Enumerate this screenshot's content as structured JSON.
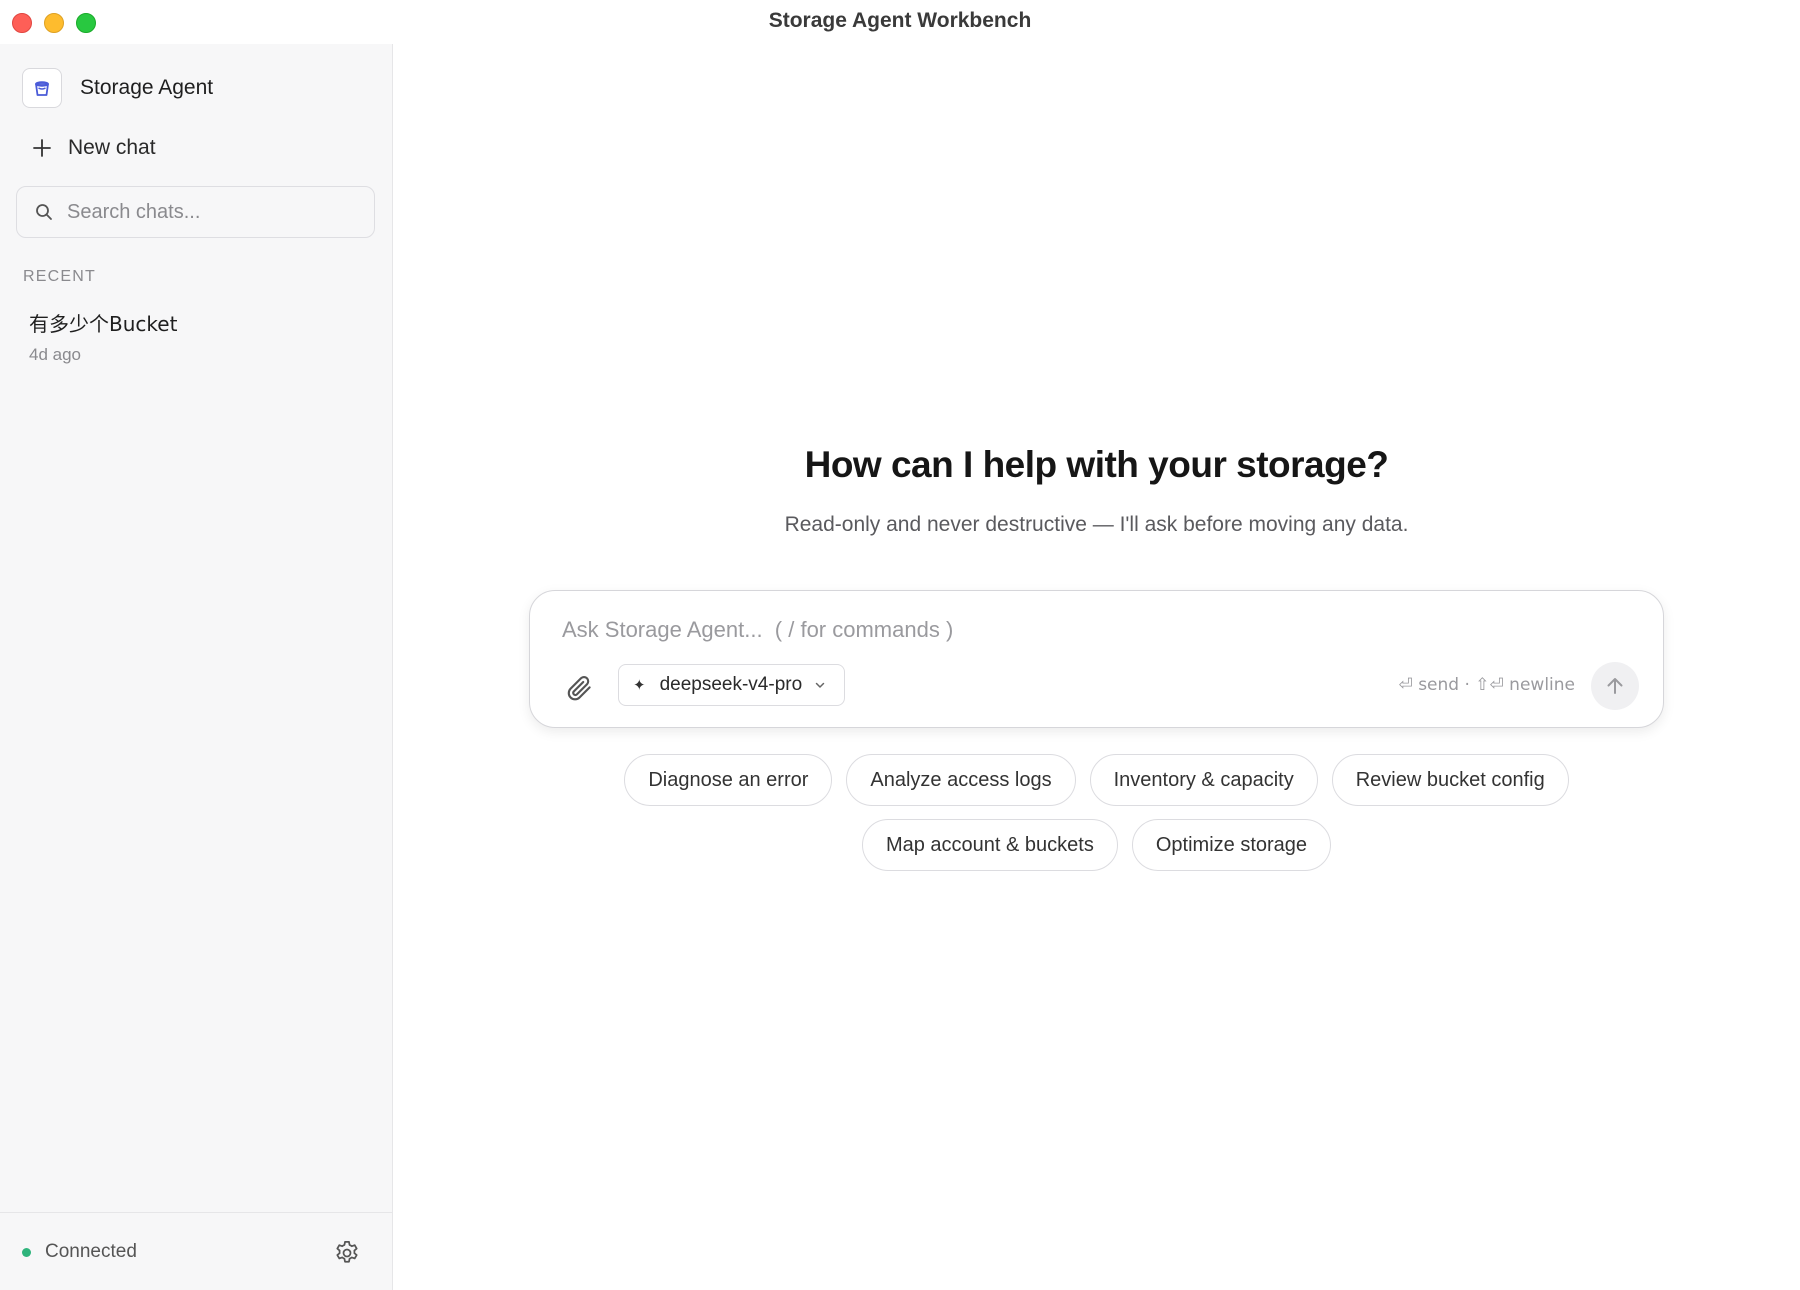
{
  "window": {
    "title": "Storage Agent Workbench"
  },
  "sidebar": {
    "brand_name": "Storage Agent",
    "new_chat_label": "New chat",
    "search_placeholder": "Search chats...",
    "recent_label": "RECENT",
    "chats": [
      {
        "title": "有多少个Bucket",
        "time": "4d ago"
      }
    ],
    "status": {
      "label": "Connected",
      "color": "#2fb47c"
    }
  },
  "main": {
    "heading": "How can I help with your storage?",
    "subheading": "Read-only and never destructive — I'll ask before moving any data.",
    "composer": {
      "placeholder": "Ask Storage Agent...  ( / for commands )",
      "model": "deepseek-v4-pro",
      "hint": "⏎ send · ⇧⏎ newline"
    },
    "suggestions_row1": [
      "Diagnose an error",
      "Analyze access logs",
      "Inventory & capacity",
      "Review bucket config"
    ],
    "suggestions_row2": [
      "Map account & buckets",
      "Optimize storage"
    ]
  },
  "icons": {
    "brand": "bucket-icon",
    "new_chat": "plus-icon",
    "search": "search-icon",
    "settings": "gear-icon",
    "attach": "paperclip-icon",
    "model": "sparkle-icon",
    "dropdown": "chevron-down-icon",
    "send": "arrow-up-icon"
  }
}
